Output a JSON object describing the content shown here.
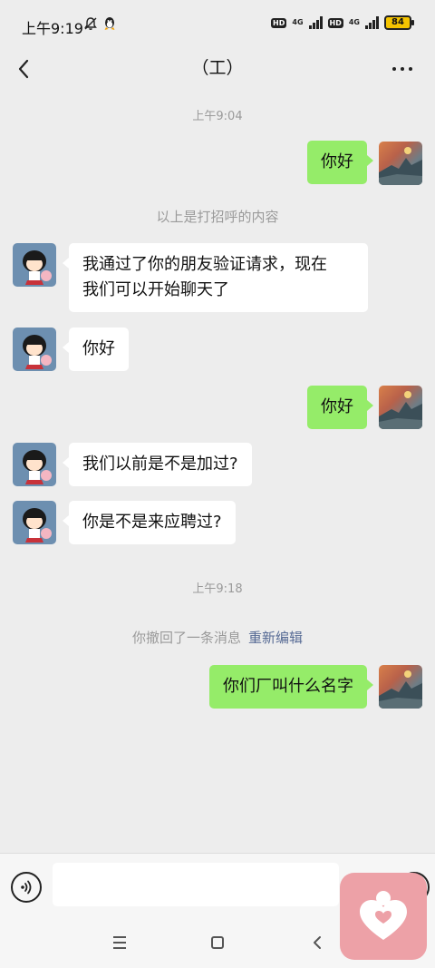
{
  "status_bar": {
    "time": "上午9:19",
    "hd1": "HD",
    "net1": "4G",
    "hd2": "HD",
    "net2": "4G",
    "battery": "84"
  },
  "header": {
    "title": "（工）"
  },
  "messages": {
    "ts1": "上午9:04",
    "out1": "你好",
    "greet_note": "以上是打招呼的内容",
    "in1_line1": "我通过了你的朋友验证请求，现在",
    "in1_line2": "我们可以开始聊天了",
    "in2": "你好",
    "out2": "你好",
    "in3": "我们以前是不是加过?",
    "in4": "你是不是来应聘过?",
    "ts2": "上午9:18",
    "recall_text": "你撤回了一条消息",
    "recall_link": "重新编辑",
    "out3": "你们厂叫什么名字"
  },
  "input": {
    "value": ""
  },
  "colors": {
    "background": "#ededed",
    "incoming_bubble": "#ffffff",
    "outgoing_bubble": "#95ec69",
    "link": "#576b95",
    "timestamp": "#9a9a9a",
    "heart_widget": "#eda1a7"
  },
  "icons": {
    "back": "chevron-left-icon",
    "more": "more-dots-icon",
    "voice": "voice-input-icon",
    "nav_menu": "recent-apps-icon",
    "nav_home": "home-icon",
    "nav_back": "back-triangle-icon",
    "heart": "heart-person-icon"
  }
}
